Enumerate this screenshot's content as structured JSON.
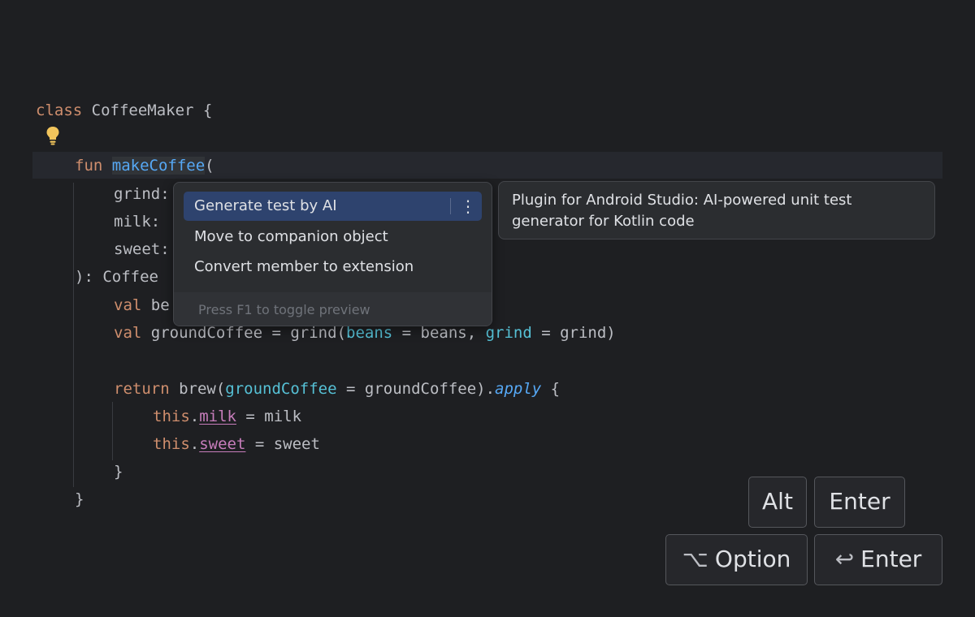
{
  "code": {
    "line1_kw": "class",
    "line1_rest": " CoffeeMaker {",
    "line2_kw": "fun",
    "line2_fn": "makeCoffee",
    "line2_paren": "(",
    "param1": "grind:",
    "param2": "milk:",
    "param3": "sweet:",
    "return_type": "): Coffee",
    "val1_kw": "val",
    "val1_rest": " be",
    "val2_kw": "val",
    "val2_a": " groundCoffee = grind(",
    "val2_p1": "beans",
    "val2_b": " = beans, ",
    "val2_p2": "grind",
    "val2_c": " = grind)",
    "ret_kw": "return",
    "ret_a": " brew(",
    "ret_p": "groundCoffee",
    "ret_b": " = groundCoffee).",
    "ret_apply": "apply",
    "ret_c": " {",
    "this1_kw": "this",
    "this1_dot": ".",
    "this1_prop": "milk",
    "this1_rest": " = milk",
    "this2_kw": "this",
    "this2_dot": ".",
    "this2_prop": "sweet",
    "this2_rest": " = sweet",
    "close_inner": "}",
    "close_outer": "}"
  },
  "intention_menu": {
    "items": [
      "Generate test by AI",
      "Move to companion object",
      "Convert member to extension"
    ],
    "selected_index": 0,
    "more_icon": "⋮",
    "footer": "Press F1 to toggle preview"
  },
  "tooltip": {
    "line1": "Plugin for Android Studio: AI-powered unit test",
    "line2": "generator for Kotlin code"
  },
  "shortcuts": {
    "windows": [
      "Alt",
      "Enter"
    ],
    "mac_option_symbol": "⌥",
    "mac_option_label": "Option",
    "mac_enter_symbol": "↩",
    "mac_enter_label": "Enter"
  },
  "icons": {
    "bulb": "lightbulb-icon"
  },
  "colors": {
    "background": "#1e1f22",
    "keyword": "#cf8e6d",
    "function": "#56a8f5",
    "named_param": "#56c1d6",
    "property": "#c77dbb",
    "selection": "#2e436e",
    "bulb": "#f2c55c"
  }
}
